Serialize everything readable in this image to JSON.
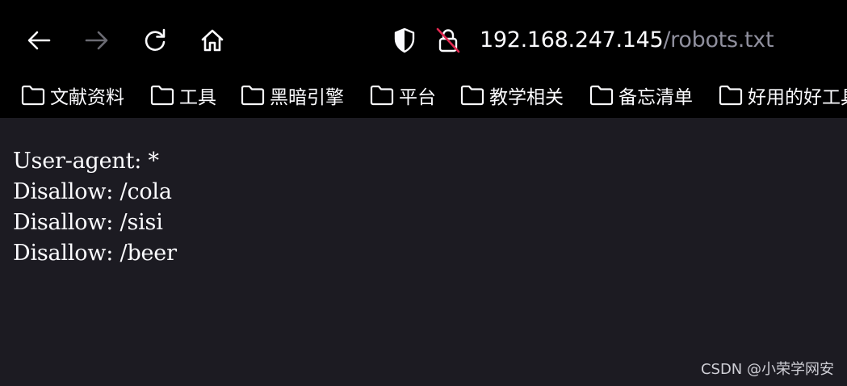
{
  "toolbar": {
    "back_icon": "arrow-left-icon",
    "forward_icon": "arrow-right-icon",
    "reload_icon": "reload-icon",
    "home_icon": "home-icon"
  },
  "url_bar": {
    "shield_icon": "shield-icon",
    "lock_icon": "lock-slashed-icon",
    "host": "192.168.247.145",
    "path": "/robots.txt"
  },
  "bookmarks": [
    {
      "label": "文献资料"
    },
    {
      "label": "工具"
    },
    {
      "label": "黑暗引擎"
    },
    {
      "label": "平台"
    },
    {
      "label": "教学相关"
    },
    {
      "label": "备忘清单"
    },
    {
      "label": "好用的好工具"
    }
  ],
  "content": {
    "lines": [
      "User-agent: *",
      "Disallow: /cola",
      "Disallow: /sisi",
      "Disallow: /beer"
    ]
  },
  "watermark": "CSDN @小荣学网安",
  "colors": {
    "toolbar_bg": "#000000",
    "content_bg": "#1c1b22",
    "text": "#fbfbfe",
    "muted": "#8f8f9d",
    "lock_slash": "#e22850"
  }
}
